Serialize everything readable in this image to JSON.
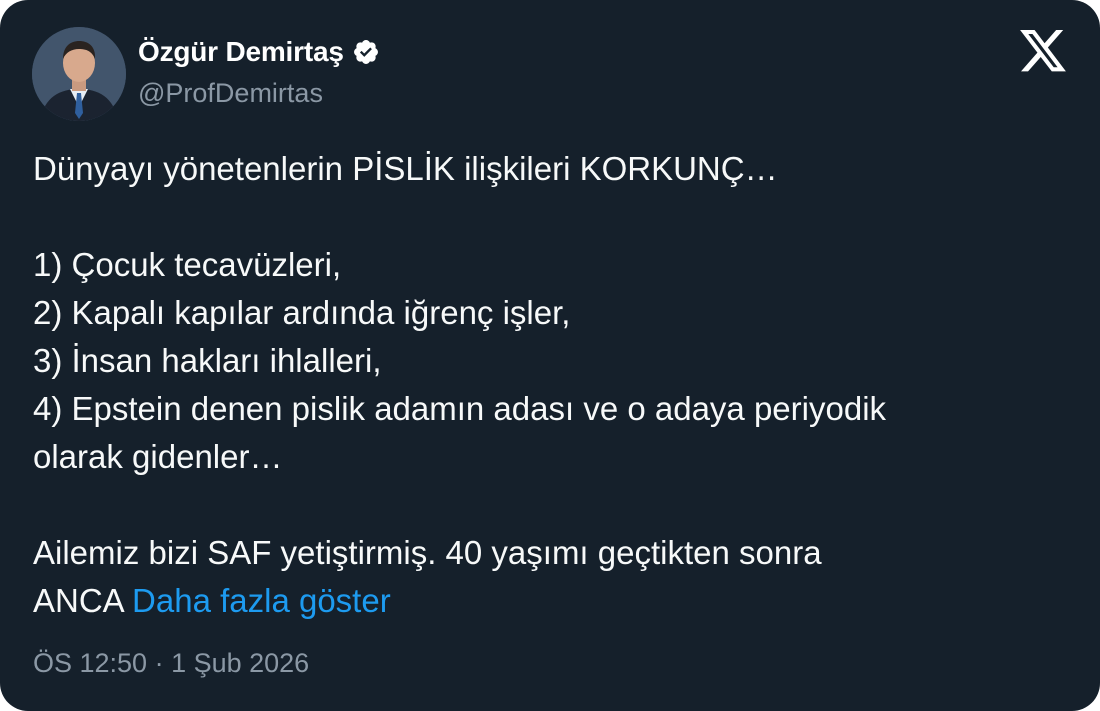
{
  "author": {
    "display_name": "Özgür Demirtaş",
    "handle": "@ProfDemirtas",
    "verified": true,
    "verified_color": "#ffffff"
  },
  "tweet": {
    "lines": [
      "Dünyayı yönetenlerin PİSLİK ilişkileri KORKUNÇ…",
      "1) Çocuk tecavüzleri,",
      "2) Kapalı kapılar ardında iğrenç işler,",
      "3) İnsan hakları ihlalleri,",
      "4) Epstein denen pislik adamın adası ve o adaya periyodik",
      "olarak gidenler…",
      "Ailemiz bizi SAF yetiştirmiş. 40 yaşımı geçtikten sonra",
      "ANCA"
    ],
    "show_more": "Daha fazla göster",
    "timestamp": "ÖS 12:50 · 1 Şub 2026"
  },
  "icons": {
    "platform": "x-logo-icon",
    "verified": "verified-badge-icon"
  },
  "colors": {
    "background": "#15202b",
    "text": "#f7f9f9",
    "secondary": "#8b98a5",
    "link": "#1d9bf0"
  }
}
